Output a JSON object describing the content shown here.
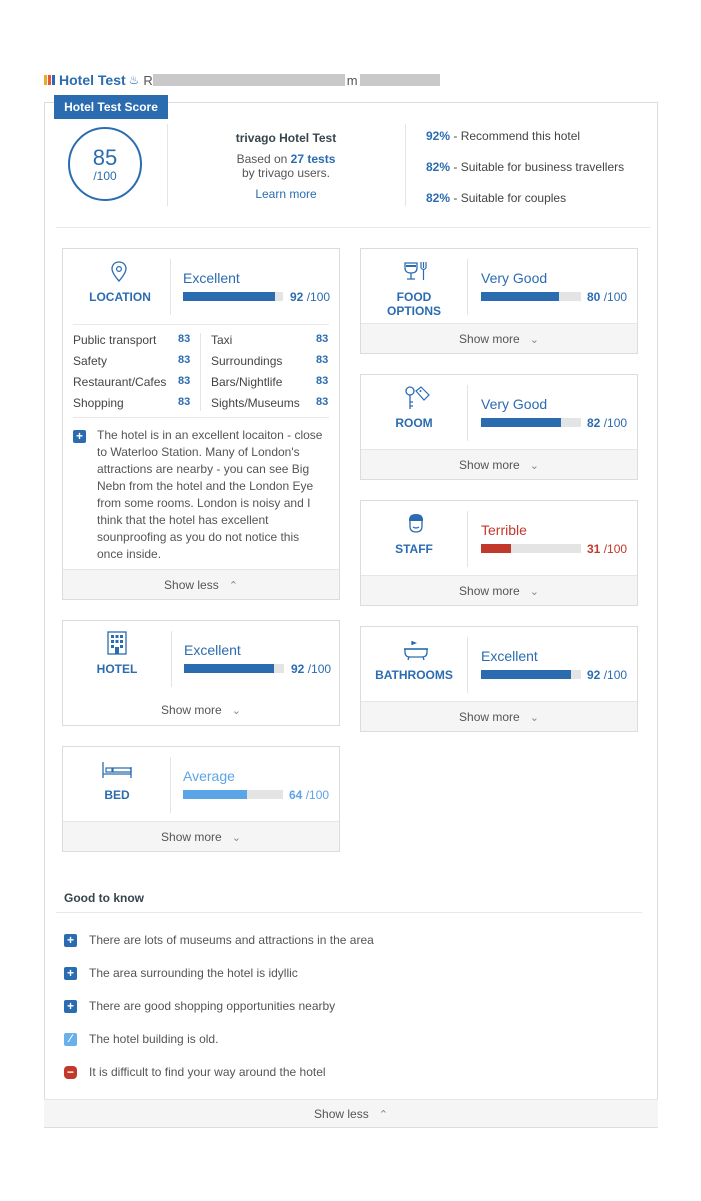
{
  "header": {
    "title": "Hotel Test",
    "hat_icon": "chef-hat-icon",
    "redacted_prefix": "R",
    "redacted_mid": "m",
    "brand_colors": [
      "#f5a623",
      "#e3573d",
      "#2b6cb0"
    ]
  },
  "score": {
    "tag": "Hotel Test Score",
    "value": "85",
    "out_of": "/100"
  },
  "test": {
    "title": "trivago Hotel Test",
    "based_on": "Based on",
    "count": "27 tests",
    "by": "by trivago users.",
    "learn_more": "Learn more"
  },
  "stats": [
    {
      "pct": "92%",
      "text": " - Recommend this hotel"
    },
    {
      "pct": "82%",
      "text": " - Suitable for business travellers"
    },
    {
      "pct": "82%",
      "text": " - Suitable for couples"
    }
  ],
  "categories": {
    "location": {
      "name": "LOCATION",
      "icon": "map-pin-icon",
      "rating": "Excellent",
      "score": "92",
      "of": "/100",
      "fill": 0.92,
      "color": "#2b6cb0",
      "toggle": "Show less"
    },
    "food": {
      "name1": "FOOD",
      "name2": "OPTIONS",
      "icon": "food-icon",
      "rating": "Very Good",
      "score": "80",
      "of": "/100",
      "fill": 0.78,
      "color": "#2b6cb0",
      "toggle": "Show more"
    },
    "room": {
      "name": "ROOM",
      "icon": "key-icon",
      "rating": "Very Good",
      "score": "82",
      "of": "/100",
      "fill": 0.8,
      "color": "#2b6cb0",
      "toggle": "Show more"
    },
    "staff": {
      "name": "STAFF",
      "icon": "staff-icon",
      "rating": "Terrible",
      "score": "31",
      "of": "/100",
      "fill": 0.3,
      "color": "#c0392b",
      "toggle": "Show more"
    },
    "hotel": {
      "name": "HOTEL",
      "icon": "building-icon",
      "rating": "Excellent",
      "score": "92",
      "of": "/100",
      "fill": 0.9,
      "color": "#2b6cb0",
      "toggle": "Show more"
    },
    "bathrooms": {
      "name": "BATHROOMS",
      "icon": "bathtub-icon",
      "rating": "Excellent",
      "score": "92",
      "of": "/100",
      "fill": 0.9,
      "color": "#2b6cb0",
      "toggle": "Show more"
    },
    "bed": {
      "name": "BED",
      "icon": "bed-icon",
      "rating": "Average",
      "score": "64",
      "of": "/100",
      "fill": 0.64,
      "color": "#5ba4e6",
      "toggle": "Show more"
    }
  },
  "location_subs": {
    "left": [
      {
        "label": "Public transport",
        "score": "83"
      },
      {
        "label": "Safety",
        "score": "83"
      },
      {
        "label": "Restaurant/Cafes",
        "score": "83"
      },
      {
        "label": "Shopping",
        "score": "83"
      }
    ],
    "right": [
      {
        "label": "Taxi",
        "score": "83"
      },
      {
        "label": "Surroundings",
        "score": "83"
      },
      {
        "label": "Bars/Nightlife",
        "score": "83"
      },
      {
        "label": "Sights/Museums",
        "score": "83"
      }
    ]
  },
  "location_note": [
    "The hotel is in an excellent locaiton - close",
    "to Waterloo Station. Many of London's",
    "attractions are nearby - you can see Big",
    "Nebn from the hotel and the London Eye",
    "from some rooms. London is noisy and I",
    "think that the hotel has excellent",
    "sounproofing as you do not notice this",
    "once inside."
  ],
  "good_to_know": {
    "title": "Good to know",
    "items": [
      {
        "type": "plus",
        "text": "There are lots of museums and attractions in the area"
      },
      {
        "type": "plus",
        "text": "The area surrounding the hotel is idyllic"
      },
      {
        "type": "plus",
        "text": "There are good shopping opportunities nearby"
      },
      {
        "type": "neutral",
        "text": "The hotel building is old."
      },
      {
        "type": "minus",
        "text": "It is difficult to find your way around the hotel"
      }
    ]
  },
  "footer": {
    "toggle": "Show less"
  }
}
